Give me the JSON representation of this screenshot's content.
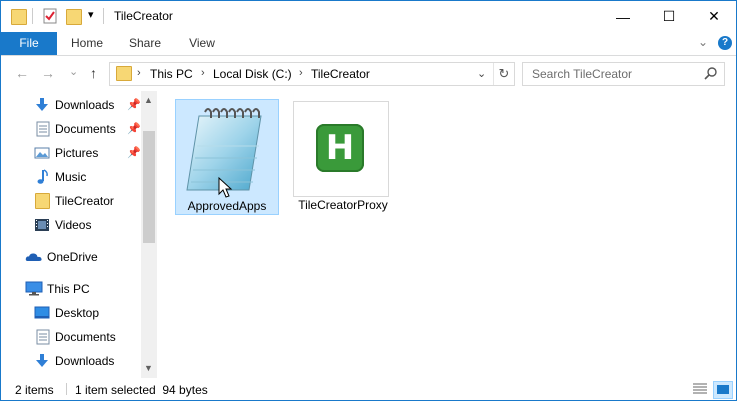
{
  "window": {
    "title": "TileCreator",
    "controls": {
      "minimize": "—",
      "maximize": "☐",
      "close": "✕"
    }
  },
  "ribbon": {
    "tabs": [
      {
        "label": "File"
      },
      {
        "label": "Home"
      },
      {
        "label": "Share"
      },
      {
        "label": "View"
      }
    ],
    "expand_glyph": "⌄",
    "help_glyph": "?"
  },
  "address": {
    "back_glyph": "←",
    "forward_glyph": "→",
    "recent_glyph": "⌄",
    "up_glyph": "↑",
    "breadcrumbs": [
      "This PC",
      "Local Disk (C:)",
      "TileCreator"
    ],
    "separator": "›",
    "refresh_glyph": "↻"
  },
  "search": {
    "placeholder": "Search TileCreator"
  },
  "nav": {
    "quick_access": [
      {
        "label": "Downloads",
        "icon": "downloads-icon",
        "pinned": true
      },
      {
        "label": "Documents",
        "icon": "documents-icon",
        "pinned": true
      },
      {
        "label": "Pictures",
        "icon": "pictures-icon",
        "pinned": true
      },
      {
        "label": "Music",
        "icon": "music-icon",
        "pinned": false
      },
      {
        "label": "TileCreator",
        "icon": "folder-icon",
        "pinned": false
      },
      {
        "label": "Videos",
        "icon": "videos-icon",
        "pinned": false
      }
    ],
    "onedrive": {
      "label": "OneDrive",
      "icon": "onedrive-icon"
    },
    "thispc": {
      "label": "This PC",
      "icon": "computer-icon"
    },
    "thispc_children": [
      {
        "label": "Desktop",
        "icon": "desktop-icon"
      },
      {
        "label": "Documents",
        "icon": "documents-icon"
      },
      {
        "label": "Downloads",
        "icon": "downloads-icon"
      }
    ],
    "pin_glyph": "📌"
  },
  "files": [
    {
      "name": "ApprovedApps",
      "icon": "notepad-icon",
      "selected": true
    },
    {
      "name": "TileCreatorProxy",
      "icon": "h-app-icon",
      "selected": false,
      "icon_letter": "H"
    }
  ],
  "status": {
    "item_count": "2 items",
    "selection": "1 item selected  94 bytes"
  },
  "colors": {
    "accent": "#1979ca",
    "selection_bg": "#cce8ff",
    "selection_border": "#99d1ff",
    "app_icon_green": "#3a9a3a"
  }
}
